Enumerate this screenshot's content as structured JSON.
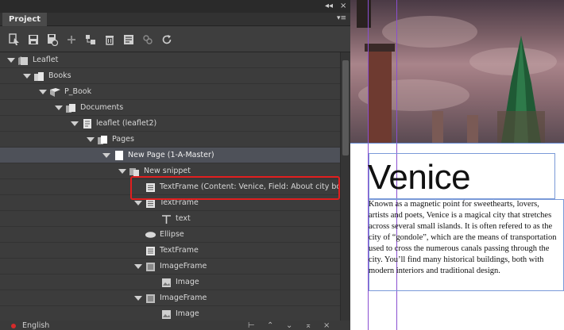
{
  "panel": {
    "title": "Project",
    "collapse_glyph": "◂◂",
    "close_glyph": "×",
    "menu_glyph": "▾≡"
  },
  "toolbar": {
    "tools": [
      {
        "name": "select-icon"
      },
      {
        "name": "save-icon"
      },
      {
        "name": "save-as-icon"
      },
      {
        "name": "add-icon"
      },
      {
        "name": "add-child-icon"
      },
      {
        "name": "delete-icon"
      },
      {
        "name": "properties-icon"
      },
      {
        "name": "link-icon"
      },
      {
        "name": "refresh-icon"
      }
    ]
  },
  "tree": {
    "rows": [
      {
        "label": "Leaflet",
        "icon": "folder-icon",
        "expanded": true
      },
      {
        "label": "Books",
        "icon": "books-icon",
        "expanded": true
      },
      {
        "label": "P_Book",
        "icon": "book-icon",
        "expanded": true
      },
      {
        "label": "Documents",
        "icon": "documents-icon",
        "expanded": true
      },
      {
        "label": "leaflet (leaflet2)",
        "icon": "document-icon",
        "expanded": true
      },
      {
        "label": "Pages",
        "icon": "pages-icon",
        "expanded": true
      },
      {
        "label": "New Page (1-A-Master)",
        "icon": "page-icon",
        "expanded": true
      },
      {
        "label": "New snippet",
        "icon": "snippet-icon",
        "expanded": true
      },
      {
        "label": "TextFrame (Content: Venice, Field: About city body)",
        "icon": "textframe-icon",
        "expanded": false
      },
      {
        "label": "TextFrame",
        "icon": "textframe-icon",
        "expanded": true
      },
      {
        "label": "text",
        "icon": "text-icon",
        "expanded": false
      },
      {
        "label": "Ellipse",
        "icon": "ellipse-icon",
        "expanded": false
      },
      {
        "label": "TextFrame",
        "icon": "textframe-icon",
        "expanded": false
      },
      {
        "label": "ImageFrame",
        "icon": "imageframe-icon",
        "expanded": true
      },
      {
        "label": "Image",
        "icon": "image-icon",
        "expanded": false
      },
      {
        "label": "ImageFrame",
        "icon": "imageframe-icon",
        "expanded": true
      },
      {
        "label": "Image",
        "icon": "image-icon",
        "expanded": false
      }
    ]
  },
  "footer": {
    "language": "English"
  },
  "document": {
    "headline": "Venice",
    "body": "Known as a magnetic point for sweethearts, lovers, artists and poets, Venice is a magical city that stretches across several small islands. It is often refered to as the city of “gondole”, which are the means of transportation used to cross the numerous canals passing through the city. You’ll find many historical buildings, both with modern interiors and traditional design."
  },
  "colors": {
    "highlight": "#e11e1e",
    "selected_row": "#4e5159",
    "guide_purple": "#8a4fd1",
    "guide_blue": "#6a8fd8"
  }
}
